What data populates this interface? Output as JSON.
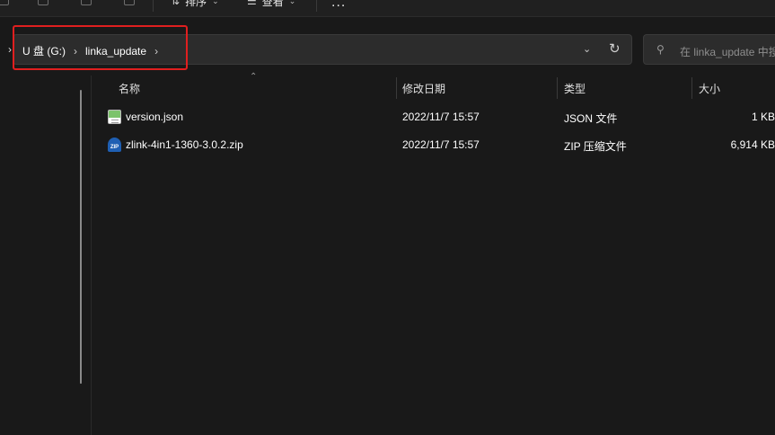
{
  "toolbar": {
    "sort_label": "排序",
    "view_label": "查看",
    "more_label": "..."
  },
  "address": {
    "crumbs": [
      "U 盘 (G:)",
      "linka_update"
    ],
    "separator": "›"
  },
  "search": {
    "placeholder": "在 linka_update 中搜索"
  },
  "columns": {
    "name": "名称",
    "modified": "修改日期",
    "type": "类型",
    "size": "大小"
  },
  "files": [
    {
      "name": "version.json",
      "modified": "2022/11/7 15:57",
      "type": "JSON 文件",
      "size": "1 KB",
      "icon": "json-file-icon"
    },
    {
      "name": "zlink-4in1-1360-3.0.2.zip",
      "modified": "2022/11/7 15:57",
      "type": "ZIP 压缩文件",
      "size": "6,914 KB",
      "icon": "zip-file-icon",
      "icon_label": "ZIP"
    }
  ],
  "colors": {
    "background": "#191919",
    "highlight": "#e01f1f"
  }
}
